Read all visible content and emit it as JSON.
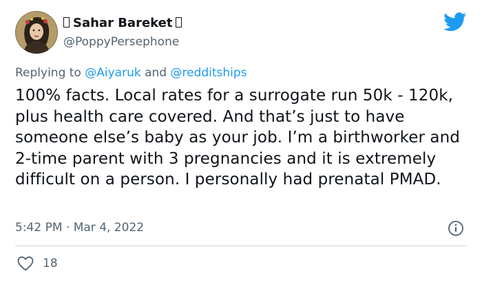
{
  "author": {
    "name": "Sahar Bareket",
    "handle": "@PoppyPersephone",
    "avatar_icon": "profile-portrait-icon"
  },
  "brand": {
    "icon": "twitter-bird-icon",
    "color": "#1d9bf0"
  },
  "reply": {
    "prefix": "Replying to",
    "mention_1": "@Aiyaruk",
    "connector": "and",
    "mention_2": "@redditships"
  },
  "tweet": {
    "text": "100% facts. Local rates for a surrogate run 50k - 120k, plus health care covered. And that’s just to have someone else’s baby as your job. I’m a birthworker and 2-time parent with 3 pregnancies and it is extremely difficult on a person. I personally had prenatal PMAD.",
    "timestamp": "5:42 PM · Mar 4, 2022"
  },
  "actions": {
    "like_icon": "heart-icon",
    "like_count": "18",
    "info_icon": "info-icon"
  },
  "colors": {
    "text": "#0f1419",
    "secondary": "#536471",
    "divider": "#cfd9de",
    "link": "#1d9bf0"
  }
}
